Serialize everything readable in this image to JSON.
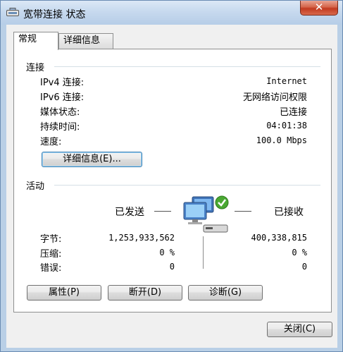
{
  "window": {
    "title": "宽带连接 状态",
    "close_label": "✕"
  },
  "tabs": [
    {
      "label": "常规",
      "active": true
    },
    {
      "label": "详细信息",
      "active": false
    }
  ],
  "connection": {
    "heading": "连接",
    "rows": [
      {
        "label": "IPv4 连接:",
        "value": "Internet"
      },
      {
        "label": "IPv6 连接:",
        "value": "无网络访问权限"
      },
      {
        "label": "媒体状态:",
        "value": "已连接"
      },
      {
        "label": "持续时间:",
        "value": "04:01:38"
      },
      {
        "label": "速度:",
        "value": "100.0 Mbps"
      }
    ],
    "details_button": "详细信息(E)..."
  },
  "activity": {
    "heading": "活动",
    "sent_label": "已发送",
    "received_label": "已接收",
    "rows": [
      {
        "label": "字节:",
        "sent": "1,253,933,562",
        "received": "400,338,815"
      },
      {
        "label": "压缩:",
        "sent": "0 %",
        "received": "0 %"
      },
      {
        "label": "错误:",
        "sent": "0",
        "received": "0"
      }
    ]
  },
  "buttons": {
    "properties": "属性(P)",
    "disconnect": "断开(D)",
    "diagnose": "诊断(G)",
    "close": "关闭(C)"
  },
  "icons": {
    "title": "network-connection-icon",
    "activity": "network-computers-icon"
  }
}
